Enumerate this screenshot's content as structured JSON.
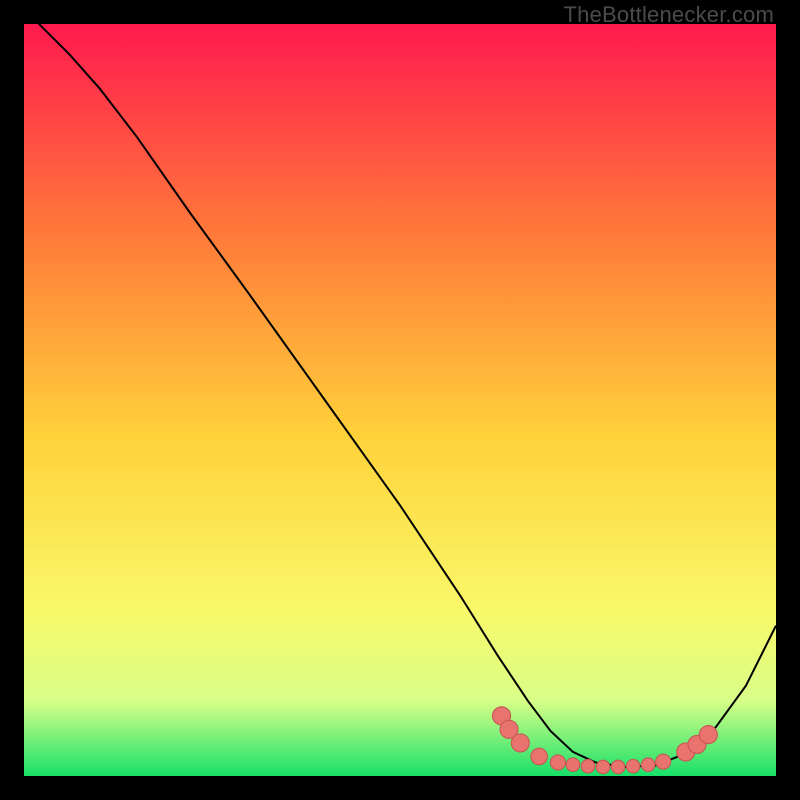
{
  "watermark": "TheBottlenecker.com",
  "colors": {
    "bg_black": "#000000",
    "grad_top": "#ff1a4e",
    "grad_mid_upper": "#ff7a3a",
    "grad_mid": "#ffd23a",
    "grad_mid_lower": "#f9f96a",
    "grad_lower": "#d8ff88",
    "grad_bottom": "#17e069",
    "curve": "#000000",
    "marker_fill": "#e9736f",
    "marker_stroke": "#c75854"
  },
  "chart_data": {
    "type": "line",
    "title": "",
    "xlabel": "",
    "ylabel": "",
    "xlim": [
      0,
      100
    ],
    "ylim": [
      0,
      100
    ],
    "grid": false,
    "legend": null,
    "series": [
      {
        "name": "bottleneck-curve",
        "x": [
          0,
          3,
          6,
          10,
          15,
          22,
          30,
          40,
          50,
          58,
          63,
          67,
          70,
          73,
          76,
          80,
          84,
          88,
          92,
          96,
          100
        ],
        "y": [
          102,
          99,
          96,
          91.5,
          85,
          75,
          64,
          50,
          36,
          24,
          16,
          10,
          6,
          3.2,
          1.8,
          1.2,
          1.4,
          3,
          6.5,
          12,
          20
        ]
      }
    ],
    "markers": [
      {
        "x": 63.5,
        "y": 8.0,
        "r": 1.2
      },
      {
        "x": 64.5,
        "y": 6.2,
        "r": 1.2
      },
      {
        "x": 66.0,
        "y": 4.4,
        "r": 1.2
      },
      {
        "x": 68.5,
        "y": 2.6,
        "r": 1.1
      },
      {
        "x": 71.0,
        "y": 1.8,
        "r": 1.0
      },
      {
        "x": 73.0,
        "y": 1.5,
        "r": 0.9
      },
      {
        "x": 75.0,
        "y": 1.3,
        "r": 0.9
      },
      {
        "x": 77.0,
        "y": 1.2,
        "r": 0.9
      },
      {
        "x": 79.0,
        "y": 1.2,
        "r": 0.9
      },
      {
        "x": 81.0,
        "y": 1.3,
        "r": 0.9
      },
      {
        "x": 83.0,
        "y": 1.5,
        "r": 0.9
      },
      {
        "x": 85.0,
        "y": 1.9,
        "r": 1.0
      },
      {
        "x": 88.0,
        "y": 3.2,
        "r": 1.2
      },
      {
        "x": 89.5,
        "y": 4.2,
        "r": 1.2
      },
      {
        "x": 91.0,
        "y": 5.5,
        "r": 1.2
      }
    ],
    "gradient_stops": [
      {
        "offset": 0.0,
        "key": "grad_top"
      },
      {
        "offset": 0.28,
        "key": "grad_mid_upper"
      },
      {
        "offset": 0.55,
        "key": "grad_mid"
      },
      {
        "offset": 0.78,
        "key": "grad_mid_lower"
      },
      {
        "offset": 0.9,
        "key": "grad_lower"
      },
      {
        "offset": 1.0,
        "key": "grad_bottom"
      }
    ]
  }
}
